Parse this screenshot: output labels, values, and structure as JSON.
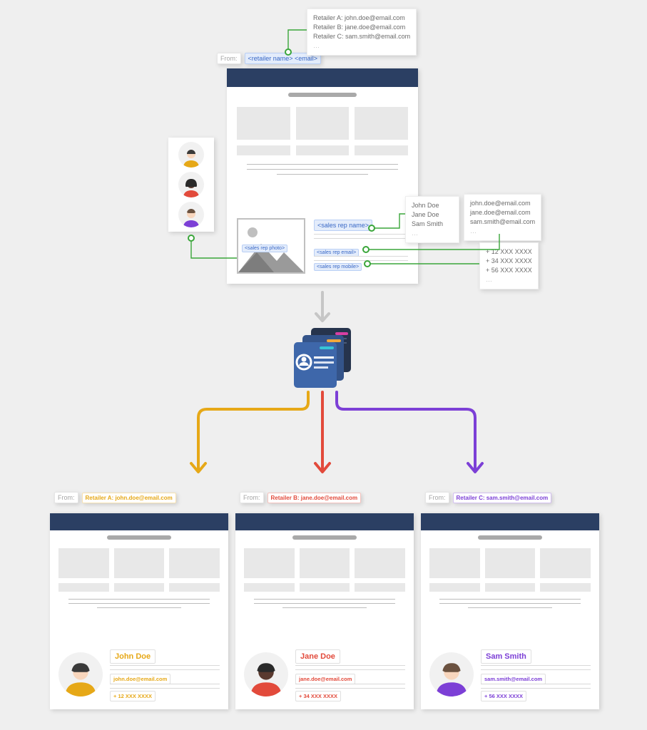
{
  "template": {
    "from_label": "From:",
    "from_token": "<retailer name> <email>",
    "retailers_tooltip": [
      "Retailer A: john.doe@email.com",
      "Retailer B: jane.doe@email.com",
      "Retailer C: sam.smith@email.com"
    ],
    "photo_token": "<sales rep photo>",
    "sig_tokens": {
      "name": "<sales rep name>",
      "email": "<sales rep email>",
      "mobile": "<sales rep mobile>"
    },
    "name_tooltip": [
      "John Doe",
      "Jane Doe",
      "Sam Smith"
    ],
    "email_tooltip": [
      "john.doe@email.com",
      "jane.doe@email.com",
      "sam.smith@email.com"
    ],
    "mobile_tooltip": [
      "+ 12 XXX XXXX",
      "+ 34 XXX XXXX",
      "+ 56 XXX XXXX"
    ],
    "ellipsis": "…"
  },
  "colors": {
    "yellow": "#e6a817",
    "red": "#e24a3b",
    "purple": "#7c3fd6"
  },
  "results": [
    {
      "color_key": "yellow",
      "from_label": "From:",
      "from_value": "Retailer A: john.doe@email.com",
      "name": "John Doe",
      "email": "john.doe@email.com",
      "mobile": "+ 12 XXX XXXX",
      "skin": "#f8d6bd",
      "hair": "#3a3a3a"
    },
    {
      "color_key": "red",
      "from_label": "From:",
      "from_value": "Retailer B: jane.doe@email.com",
      "name": "Jane Doe",
      "email": "jane.doe@email.com",
      "mobile": "+ 34 XXX XXXX",
      "skin": "#5a3a2f",
      "hair": "#2a2a2a"
    },
    {
      "color_key": "purple",
      "from_label": "From:",
      "from_value": "Retailer C: sam.smith@email.com",
      "name": "Sam Smith",
      "email": "sam.smith@email.com",
      "mobile": "+ 56 XXX XXXX",
      "skin": "#f8d6bd",
      "hair": "#6b5240"
    }
  ]
}
